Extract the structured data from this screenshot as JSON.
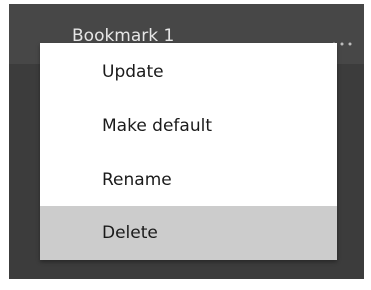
{
  "bookmark": {
    "label": "Bookmark 1",
    "more_icon": "ellipsis-icon"
  },
  "menu": {
    "items": [
      {
        "label": "Update"
      },
      {
        "label": "Make default"
      },
      {
        "label": "Rename"
      },
      {
        "label": "Delete",
        "state": "hovered"
      }
    ]
  },
  "colors": {
    "panel_background": "#3c3c3c",
    "row_background": "#474747",
    "menu_background": "#ffffff",
    "hover_background": "#cccccc"
  }
}
